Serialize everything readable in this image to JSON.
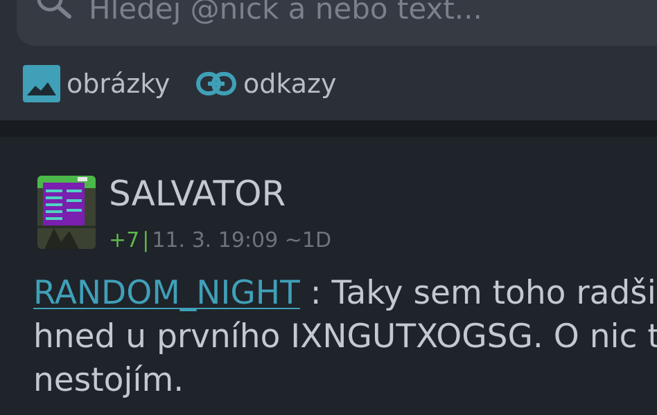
{
  "search": {
    "placeholder": "Hledej @nick a nebo text..."
  },
  "filters": {
    "images_label": "obrázky",
    "links_label": "odkazy"
  },
  "post": {
    "author": "SALVATOR",
    "score": "+7",
    "separator": "|",
    "timestamp": "11. 3. 19:09 ~1D",
    "mention": "RANDOM_NIGHT",
    "line1_rest": " : Taky sem toho radši",
    "line2": "hned u prvního IXNGUTXOGSG. O nic ta",
    "line3": "nestojím."
  },
  "colors": {
    "accent": "#3fa0b8",
    "score_green": "#5fb84a",
    "background": "#1f232a",
    "header": "#2b3038"
  }
}
